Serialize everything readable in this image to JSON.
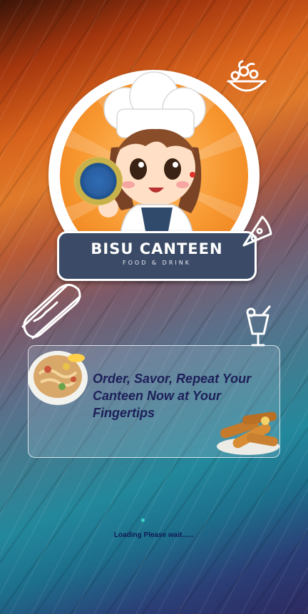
{
  "logo": {
    "title": "BISU CANTEEN",
    "subtitle": "FOOD & DRINK",
    "mascot_icon": "chef-girl-mascot-icon",
    "seal_icon": "university-seal-icon"
  },
  "doodles": {
    "top_right": "salad-bowl-icon",
    "pizza": "pizza-slice-icon",
    "hotdog": "hotdog-icon",
    "drink": "cocktail-drink-icon"
  },
  "card": {
    "tagline": "Order, Savor, Repeat Your Canteen Now at Your Fingertips",
    "image_left": "noodle-dish-image",
    "image_right": "fried-spring-rolls-image"
  },
  "loading": {
    "text": "Loading Please wait......"
  },
  "colors": {
    "banner": "#3b4b67",
    "tagline": "#1d1f59",
    "loading_text": "#0e1b55",
    "logo_orange": "#f7962e"
  }
}
